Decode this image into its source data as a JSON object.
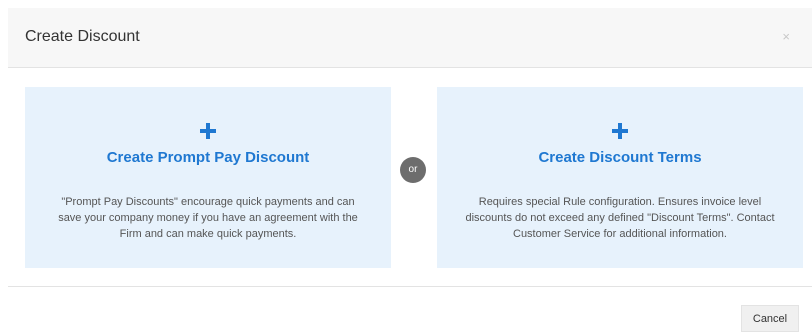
{
  "modal": {
    "title": "Create Discount",
    "close_label": "×"
  },
  "options": [
    {
      "icon": "plus-icon",
      "title": "Create Prompt Pay Discount",
      "description": "\"Prompt Pay Discounts\" encourage quick payments and can save your company money if you have an agreement with the Firm and can make quick payments."
    },
    {
      "icon": "plus-icon",
      "title": "Create Discount Terms",
      "description": "Requires special Rule configuration. Ensures invoice level discounts do not exceed any defined \"Discount Terms\". Contact Customer Service for additional information."
    }
  ],
  "separator": {
    "label": "or"
  },
  "footer": {
    "cancel_label": "Cancel"
  },
  "colors": {
    "accent": "#1f78d1",
    "card_background": "#e7f2fc",
    "badge": "#6d6d6d"
  }
}
